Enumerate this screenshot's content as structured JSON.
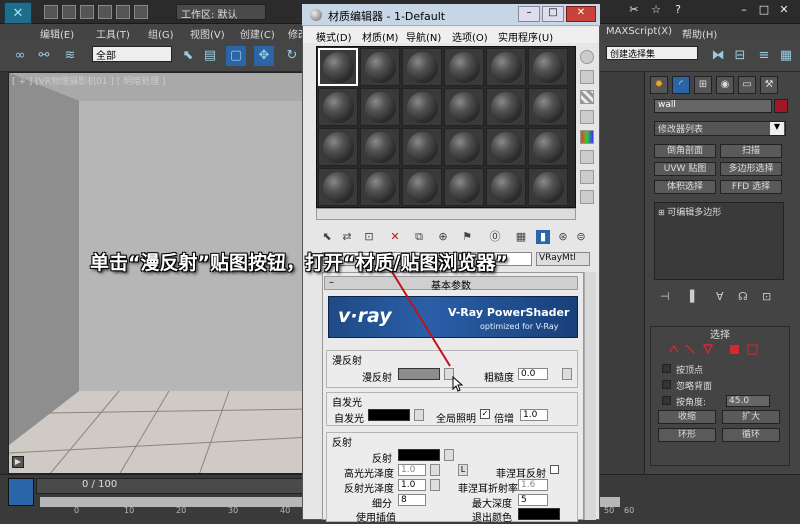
{
  "main_window": {
    "workspace_label": "工作区: 默认",
    "menu": [
      "编辑(E)",
      "工具(T)",
      "组(G)",
      "视图(V)",
      "创建(C)",
      "修改",
      "MAXScript(X)",
      "帮助(H)"
    ],
    "selection_filter": "全部",
    "named_selection": "创建选择集",
    "viewport_label": "[ + ] [VR物理摄影机01 ] [ 明暗处理 ]",
    "time_readout": "0 / 100",
    "timeline_ticks": [
      "0",
      "10",
      "20",
      "30",
      "40",
      "50",
      "60"
    ]
  },
  "material_editor": {
    "title": "材质编辑器 - 1-Default",
    "menu": [
      "模式(D)",
      "材质(M)",
      "导航(N)",
      "选项(O)",
      "实用程序(U)"
    ],
    "material_type": "VRayMtl",
    "sample_slot_count": 24,
    "params_header": "基本参数",
    "banner": {
      "logo": "v·ray",
      "title": "V-Ray PowerShader",
      "subtitle": "optimized for V-Ray"
    },
    "diffuse_group": {
      "title": "漫反射",
      "diffuse_label": "漫反射",
      "roughness_label": "粗糙度",
      "roughness_value": "0.0"
    },
    "selfillum_group": {
      "title": "自发光",
      "selfillum_label": "自发光",
      "gi_label": "全局照明",
      "multiplier_label": "倍增",
      "multiplier_value": "1.0"
    },
    "reflection_group": {
      "title": "反射",
      "reflect_label": "反射",
      "hilight_gloss_label": "高光光泽度",
      "hilight_gloss_value": "1.0",
      "lock_label": "L",
      "fresnel_label": "菲涅耳反射",
      "refl_gloss_label": "反射光泽度",
      "refl_gloss_value": "1.0",
      "fresnel_ior_label": "菲涅耳折射率",
      "fresnel_ior_value": "1.6",
      "subdivs_label": "细分",
      "subdivs_value": "8",
      "max_depth_label": "最大深度",
      "max_depth_value": "5",
      "interp_label": "使用插值",
      "exit_color_label": "退出颜色"
    }
  },
  "command_panel": {
    "object_name": "wall",
    "modifier_list": "修改器列表",
    "buttons": [
      "倒角剖面",
      "扫描",
      "UVW 贴图",
      "多边形选择",
      "体积选择",
      "FFD 选择"
    ],
    "stack_item": "可编辑多边形",
    "selection_title": "选择",
    "by_vertex": "按顶点",
    "ignore_backface": "忽略背面",
    "by_angle": "按角度:",
    "by_angle_value": "45.0",
    "shrink": "收缩",
    "grow": "扩大",
    "ring": "环形",
    "loop": "循环"
  },
  "annotation": "单击“漫反射”贴图按钮，打开“材质/贴图浏览器”",
  "colors": {
    "accent_blue": "#2a66a7",
    "object_color": "#a01825",
    "annotation_line": "#c0121e"
  }
}
